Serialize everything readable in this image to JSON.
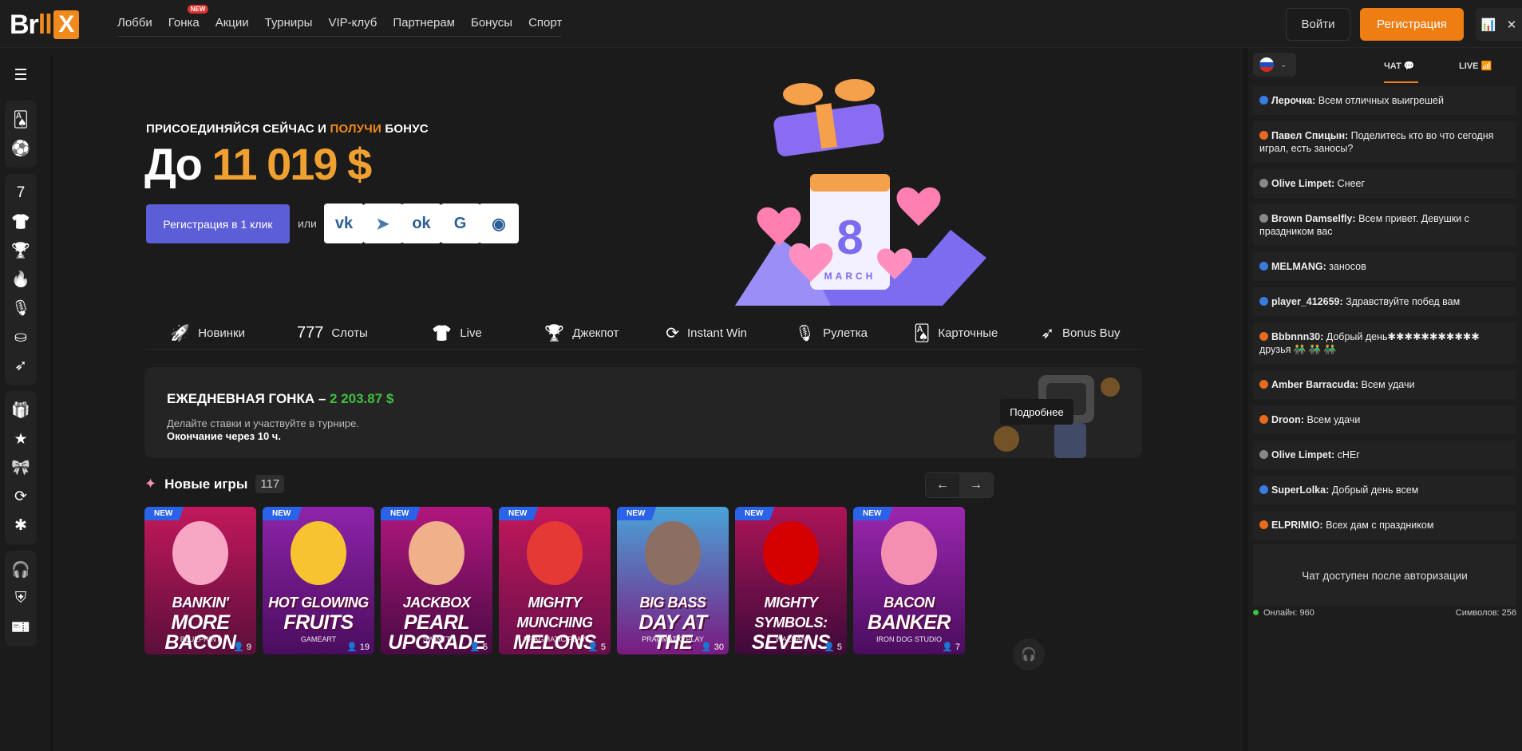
{
  "header": {
    "logo": {
      "b": "Br",
      "ll": "ll",
      "x": "X"
    },
    "nav": [
      {
        "label": "Лобби"
      },
      {
        "label": "Гонка",
        "badge": "NEW"
      },
      {
        "label": "Акции"
      },
      {
        "label": "Турниры"
      },
      {
        "label": "VIP-клуб"
      },
      {
        "label": "Партнерам"
      },
      {
        "label": "Бонусы"
      },
      {
        "label": "Спорт"
      }
    ],
    "login": "Войти",
    "register": "Регистрация"
  },
  "sidebar": {
    "groups": [
      [
        "menu-icon"
      ],
      [
        "cards-icon",
        "soccer-ball-icon"
      ],
      [
        "slots-777-icon",
        "live-shirt-icon",
        "trophy-icon",
        "fire-icon",
        "roulette-icon",
        "poker-chip-icon",
        "rocket-icon"
      ],
      [
        "gift-icon",
        "star-icon",
        "present-icon",
        "instant-win-icon",
        "network-icon"
      ],
      [
        "headset-icon",
        "shield-icon",
        "coupon-icon"
      ]
    ]
  },
  "hero": {
    "join_a": "ПРИСОЕДИНЯЙСЯ СЕЙЧАС И ",
    "join_b": "ПОЛУЧИ",
    "join_c": " БОНУС",
    "up_to": "До ",
    "amount": "11 019 $",
    "reg_button": "Регистрация в 1 клик",
    "or": "или",
    "socials": [
      {
        "name": "vk-icon",
        "glyph": "vk",
        "color": "#2d5f97"
      },
      {
        "name": "telegram-icon",
        "glyph": "➤",
        "color": "#4a78a8"
      },
      {
        "name": "odnoklassniki-icon",
        "glyph": "ok",
        "color": "#2d5f97"
      },
      {
        "name": "google-icon",
        "glyph": "G",
        "color": "#2d5f97"
      },
      {
        "name": "messenger-icon",
        "glyph": "◉",
        "color": "#2d5f97"
      }
    ],
    "calendar_day": "8",
    "calendar_month": "MARCH"
  },
  "categories": [
    {
      "label": "Новинки",
      "icon": "rocket-icon",
      "glyph": "🚀"
    },
    {
      "label": "Слоты",
      "icon": "slots-777-icon",
      "glyph": "777"
    },
    {
      "label": "Live",
      "icon": "live-shirt-icon",
      "glyph": "👕"
    },
    {
      "label": "Джекпот",
      "icon": "trophy-icon",
      "glyph": "🏆"
    },
    {
      "label": "Instant Win",
      "icon": "instant-win-icon",
      "glyph": "⟳"
    },
    {
      "label": "Рулетка",
      "icon": "roulette-icon",
      "glyph": "🎙"
    },
    {
      "label": "Карточные",
      "icon": "cards-icon",
      "glyph": "🂡"
    },
    {
      "label": "Bonus Buy",
      "icon": "bonus-buy-icon",
      "glyph": "➶"
    }
  ],
  "race": {
    "title": "ЕЖЕДНЕВНАЯ ГОНКА – ",
    "amount": "2 203.87 $",
    "subtitle": "Делайте ставки и участвуйте в турнире.",
    "ends": "Окончание через 10 ч.",
    "more": "Подробнее"
  },
  "new_games": {
    "title": "Новые игры",
    "count": "117",
    "prev": "←",
    "next": "→",
    "games": [
      {
        "badge": "NEW",
        "title1": "BANKIN'",
        "title2": "MORE BACON",
        "provider": "BLUEPRINT",
        "players": "9",
        "bg": "#c2185b",
        "bg2": "#5b0f3a",
        "art": "#f7a6c4"
      },
      {
        "badge": "NEW",
        "title1": "HOT GLOWING",
        "title2": "FRUITS",
        "provider": "GAMEART",
        "players": "19",
        "bg": "#8e24aa",
        "bg2": "#4a0d5e",
        "art": "#f7c431"
      },
      {
        "badge": "NEW",
        "title1": "JACKBOX",
        "title2": "PEARL UPGRADE",
        "provider": "SWINTT",
        "players": "5",
        "bg": "#b1177e",
        "bg2": "#4a0a44",
        "art": "#f0b08a"
      },
      {
        "badge": "NEW",
        "title1": "MIGHTY MUNCHING",
        "title2": "MELONS",
        "provider": "PRAGMATIC PLAY",
        "players": "5",
        "bg": "#c2185b",
        "bg2": "#6a0f4b",
        "art": "#e53935"
      },
      {
        "badge": "NEW",
        "title1": "BIG BASS",
        "title2": "DAY AT THE RACES",
        "provider": "PRAGMATIC PLAY",
        "players": "30",
        "bg": "#4aa3d8",
        "bg2": "#7a1a80",
        "art": "#8d6e63"
      },
      {
        "badge": "NEW",
        "title1": "MIGHTY SYMBOLS:",
        "title2": "SEVENS",
        "provider": "WAZDAN",
        "players": "5",
        "bg": "#ad1457",
        "bg2": "#3e0a3a",
        "art": "#d50000"
      },
      {
        "badge": "NEW",
        "title1": "BACON",
        "title2": "BANKER",
        "provider": "IRON DOG STUDIO",
        "players": "7",
        "bg": "#9c27b0",
        "bg2": "#4a0d5e",
        "art": "#f48fb1"
      }
    ]
  },
  "chat": {
    "tab_chat": "ЧАТ",
    "tab_live": "LIVE",
    "messages": [
      {
        "user": "Лерочка:",
        "text": " Всем отличных выигрешей",
        "color": "#3a7be0"
      },
      {
        "user": "Павел Спицын:",
        "text": " Поделитесь кто во что сегодня играл, есть заносы?",
        "color": "#e66a1f"
      },
      {
        "user": "Olive Limpet:",
        "text": " Снеег",
        "color": "#888888"
      },
      {
        "user": "Brown Damselfly:",
        "text": " Всем привет. Девушки с праздником вас",
        "color": "#888888"
      },
      {
        "user": "MELMANG:",
        "text": " заносов",
        "color": "#3a7be0"
      },
      {
        "user": "player_412659:",
        "text": " Здравствуйте побед вам",
        "color": "#3a7be0"
      },
      {
        "user": "Bbbnnn30:",
        "text": " Добрый день✱✱✱✱✱✱✱✱✱✱✱ друзья 👬 👬 👬",
        "color": "#e66a1f"
      },
      {
        "user": "Amber Barracuda:",
        "text": " Всем удачи",
        "color": "#e66a1f"
      },
      {
        "user": "Droon:",
        "text": " Всем удачи",
        "color": "#e66a1f"
      },
      {
        "user": "Olive Limpet:",
        "text": " сНЕг",
        "color": "#888888"
      },
      {
        "user": "SuperLolka:",
        "text": " Добрый день всем",
        "color": "#3a7be0"
      },
      {
        "user": "ELPRIMIO:",
        "text": " Всех дам с праздником",
        "color": "#e66a1f"
      }
    ],
    "auth_notice": "Чат доступен после авторизации",
    "online": "Онлайн: 960",
    "symbols": "Символов: 256"
  },
  "colors": {
    "accent": "#ee7d12",
    "register_blue": "#5b5ed6",
    "race_green": "#3fc03f",
    "new_badge": "#2a63e8"
  }
}
